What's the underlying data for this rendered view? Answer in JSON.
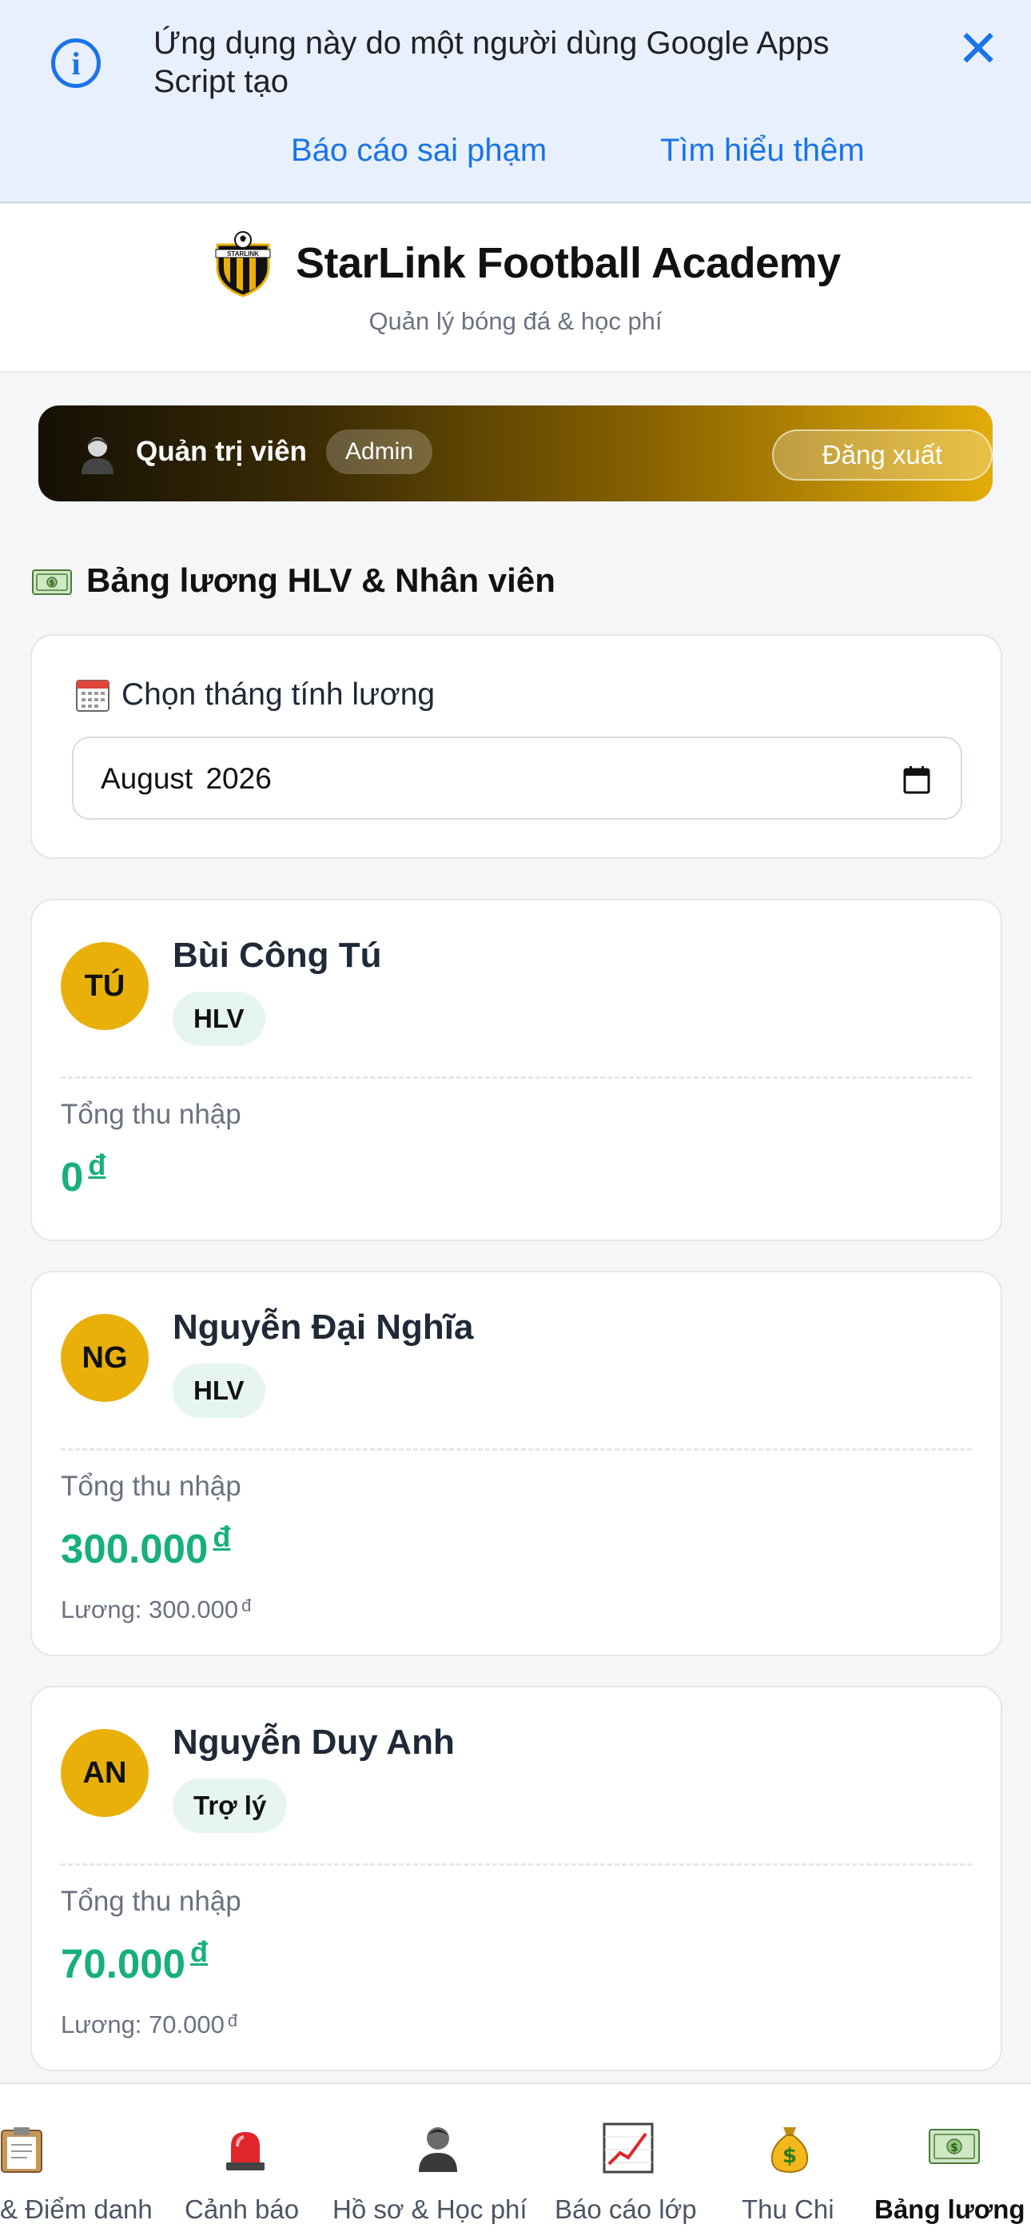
{
  "gas_banner": {
    "message": "Ứng dụng này do một người dùng Google Apps Script tạo",
    "report_link": "Báo cáo sai phạm",
    "learn_more_link": "Tìm hiểu thêm",
    "info_icon": "i"
  },
  "header": {
    "title": "StarLink Football Academy",
    "subtitle": "Quản lý bóng đá & học phí",
    "logo_text": "STARLINK"
  },
  "user_bar": {
    "role": "Quản trị viên",
    "badge": "Admin",
    "logout": "Đăng xuất"
  },
  "section": {
    "title": "Bảng lương HLV & Nhân viên"
  },
  "month_picker": {
    "label": "Chọn tháng tính lương",
    "value": "August 2026"
  },
  "staff": [
    {
      "initials": "TÚ",
      "name": "Bùi Công Tú",
      "role": "HLV",
      "income_label": "Tổng thu nhập",
      "income": "0",
      "currency": "đ",
      "salary_line": ""
    },
    {
      "initials": "NG",
      "name": "Nguyễn Đại Nghĩa",
      "role": "HLV",
      "income_label": "Tổng thu nhập",
      "income": "300.000",
      "currency": "đ",
      "salary_line": "Lương: 300.000"
    },
    {
      "initials": "AN",
      "name": "Nguyễn Duy Anh",
      "role": "Trợ lý",
      "income_label": "Tổng thu nhập",
      "income": "70.000",
      "currency": "đ",
      "salary_line": "Lương: 70.000"
    }
  ],
  "bottom_nav": [
    {
      "label": "& Điểm danh",
      "icon": "clipboard-icon",
      "active": false
    },
    {
      "label": "Cảnh báo",
      "icon": "siren-icon",
      "active": false
    },
    {
      "label": "Hồ sơ & Học phí",
      "icon": "person-icon",
      "active": false
    },
    {
      "label": "Báo cáo lớp",
      "icon": "chart-icon",
      "active": false
    },
    {
      "label": "Thu Chi",
      "icon": "money-bag-icon",
      "active": false
    },
    {
      "label": "Bảng lương",
      "icon": "banknote-icon",
      "active": true
    }
  ],
  "colors": {
    "accent_gold": "#e9b00a",
    "income_green": "#17b078",
    "link_blue": "#1a73e8"
  }
}
